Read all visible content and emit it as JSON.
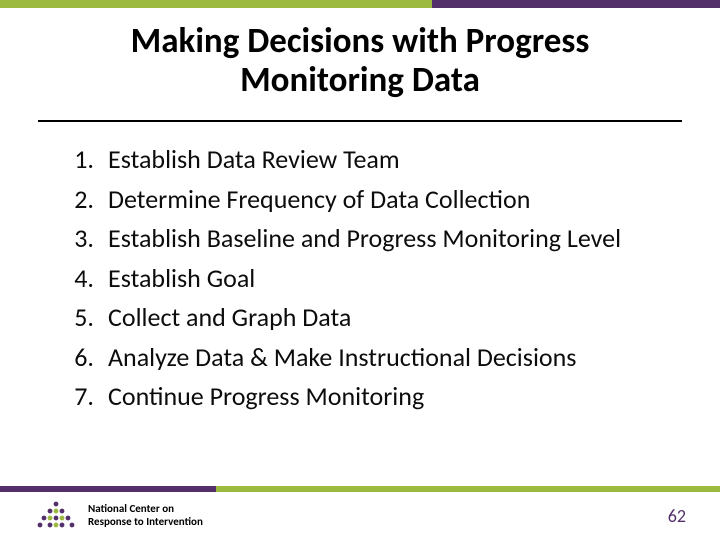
{
  "title_line1": "Making Decisions with Progress",
  "title_line2": "Monitoring Data",
  "items": [
    "Establish Data Review Team",
    "Determine Frequency of Data Collection",
    "Establish Baseline and Progress Monitoring Level",
    "Establish Goal",
    "Collect and Graph Data",
    "Analyze Data & Make Instructional Decisions",
    "Continue Progress Monitoring"
  ],
  "org_line1": "National Center on",
  "org_line2": "Response to Intervention",
  "page_number": "62",
  "colors": {
    "purple": "#53306a",
    "green": "#9cba3f"
  }
}
